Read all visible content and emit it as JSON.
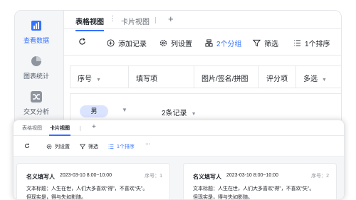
{
  "sidebar": {
    "items": [
      {
        "label": "查看数据",
        "icon": "bar-chart-icon",
        "active": true
      },
      {
        "label": "图表统计",
        "icon": "pie-chart-icon",
        "active": false
      },
      {
        "label": "交叉分析",
        "icon": "shuffle-icon",
        "active": false
      }
    ]
  },
  "back": {
    "tabs": [
      "表格视图",
      "卡片视图"
    ],
    "tab_more": "⋮",
    "add_tab": "+",
    "toolbar": {
      "refresh_icon": "refresh-icon",
      "add_record": "添加记录",
      "columns": "列设置",
      "group": "2个分组",
      "filter": "筛选",
      "sort": "1个排序"
    },
    "columns": [
      "序号",
      "填写项",
      "图片/签名/拼图",
      "评分项",
      "多选"
    ],
    "group_row": {
      "tag": "男",
      "count": "2条记录"
    }
  },
  "front": {
    "tabs": [
      "表格视图",
      "卡片视图"
    ],
    "add_tab": "+",
    "toolbar": {
      "columns": "列设置",
      "filter": "筛选",
      "sort": "1个排序",
      "more": "···"
    },
    "cards": [
      {
        "name": "名义填写人",
        "date": "2023-03-10 8:00~10:00",
        "seq": "序号：1",
        "line1": "文本标题：人生在世，人们大多喜欢“得”，不喜欢“失”。",
        "line2": "但现实是，得与失如影随。"
      },
      {
        "name": "名义填写人",
        "date": "2023-03-10 8:00~10:00",
        "seq": "序号：2",
        "line1": "文本标题：人生在世，人们大多喜欢“得”，不喜欢“失”。",
        "line2": "但现实是，得与失如影随。"
      }
    ]
  },
  "colors": {
    "accent": "#3370ff",
    "tag_bg": "#dbe4ff",
    "sidebar_bg": "#f5f6f7"
  }
}
